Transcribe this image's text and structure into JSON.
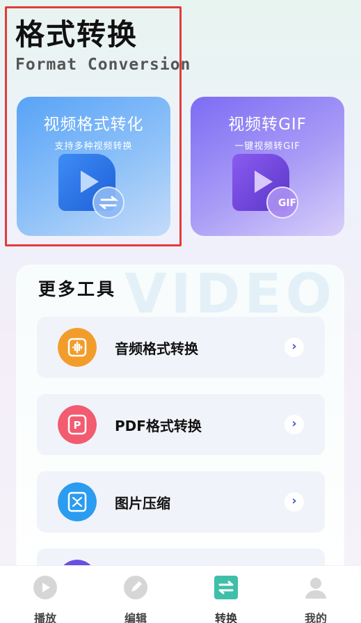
{
  "header": {
    "title": "格式转换",
    "subtitle": "Format Conversion"
  },
  "cards": [
    {
      "title": "视频格式转化",
      "subtitle": "支持多种视频转换"
    },
    {
      "title": "视频转GIF",
      "subtitle": "一键视频转GIF",
      "badge": "GIF"
    }
  ],
  "more_tools": {
    "title": "更多工具",
    "watermark": "VIDEO",
    "items": [
      {
        "label": "音频格式转换",
        "icon": "audio-convert-icon",
        "color": "#f29d2b"
      },
      {
        "label": "PDF格式转换",
        "icon": "pdf-icon",
        "color": "#f25b70"
      },
      {
        "label": "图片压缩",
        "icon": "image-compress-icon",
        "color": "#2b9cf0"
      }
    ]
  },
  "tabbar": {
    "tabs": [
      {
        "label": "播放",
        "icon": "play-icon",
        "active": false
      },
      {
        "label": "编辑",
        "icon": "edit-icon",
        "active": false
      },
      {
        "label": "转换",
        "icon": "convert-icon",
        "active": true
      },
      {
        "label": "我的",
        "icon": "profile-icon",
        "active": false
      }
    ]
  },
  "colors": {
    "accent_blue": "#58a3f7",
    "accent_purple": "#7d6cf4",
    "active_tab": "#3fbfa9",
    "highlight_border": "#e23b3b"
  }
}
